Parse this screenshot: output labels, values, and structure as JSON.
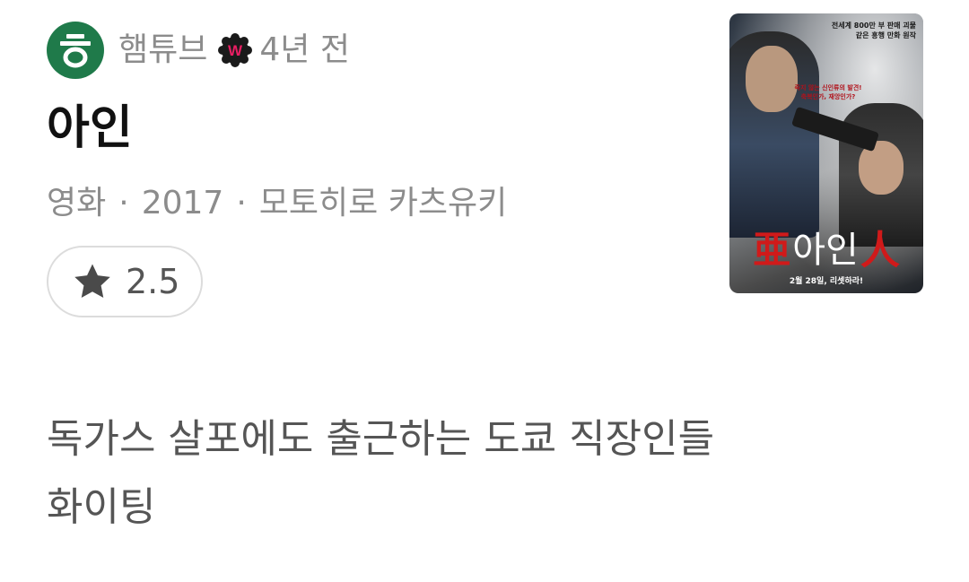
{
  "author": {
    "avatar_glyph": "ㅎ",
    "name": "햄튜브",
    "badge_letter": "W",
    "badge_color": "#c2185b",
    "time_ago": "4년 전"
  },
  "content": {
    "title": "아인",
    "category": "영화",
    "year": "2017",
    "director": "모토히로 카츠유키",
    "separator": "·",
    "rating": "2.5",
    "review_line1": "독가스 살포에도 출근하는 도쿄 직장인들",
    "review_line2": "화이팅"
  },
  "poster": {
    "tagline_top": "전세계 800만 부 판매 괴물 같은 흥행 만화 원작",
    "tagline_mid": "죽지 않는 신인류의 발견! 축복인가, 재앙인가?",
    "kanji_left": "亜",
    "title": "아인",
    "kanji_right": "人",
    "release": "2월 28일, 리셋하라!"
  },
  "colors": {
    "avatar_bg": "#1f7a4a",
    "muted_text": "#8c8c8c",
    "title_text": "#111111",
    "pill_border": "#dcdcdc"
  }
}
